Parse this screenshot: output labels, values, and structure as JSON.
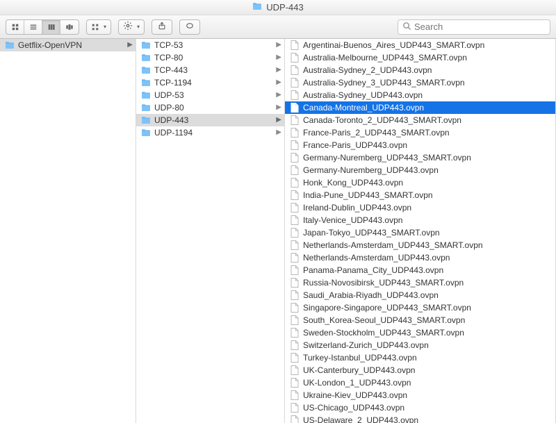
{
  "window": {
    "title": "UDP-443"
  },
  "search": {
    "placeholder": "Search"
  },
  "col1": {
    "items": [
      {
        "name": "Getflix-OpenVPN",
        "selected": true
      }
    ]
  },
  "col2": {
    "items": [
      {
        "name": "TCP-53",
        "selected": false
      },
      {
        "name": "TCP-80",
        "selected": false
      },
      {
        "name": "TCP-443",
        "selected": false
      },
      {
        "name": "TCP-1194",
        "selected": false
      },
      {
        "name": "UDP-53",
        "selected": false
      },
      {
        "name": "UDP-80",
        "selected": false
      },
      {
        "name": "UDP-443",
        "selected": true
      },
      {
        "name": "UDP-1194",
        "selected": false
      }
    ]
  },
  "col3": {
    "selected_index": 5,
    "items": [
      "Argentinai-Buenos_Aires_UDP443_SMART.ovpn",
      "Australia-Melbourne_UDP443_SMART.ovpn",
      "Australia-Sydney_2_UDP443.ovpn",
      "Australia-Sydney_3_UDP443_SMART.ovpn",
      "Australia-Sydney_UDP443.ovpn",
      "Canada-Montreal_UDP443.ovpn",
      "Canada-Toronto_2_UDP443_SMART.ovpn",
      "France-Paris_2_UDP443_SMART.ovpn",
      "France-Paris_UDP443.ovpn",
      "Germany-Nuremberg_UDP443_SMART.ovpn",
      "Germany-Nuremberg_UDP443.ovpn",
      "Honk_Kong_UDP443.ovpn",
      "India-Pune_UDP443_SMART.ovpn",
      "Ireland-Dublin_UDP443.ovpn",
      "Italy-Venice_UDP443.ovpn",
      "Japan-Tokyo_UDP443_SMART.ovpn",
      "Netherlands-Amsterdam_UDP443_SMART.ovpn",
      "Netherlands-Amsterdam_UDP443.ovpn",
      "Panama-Panama_City_UDP443.ovpn",
      "Russia-Novosibirsk_UDP443_SMART.ovpn",
      "Saudi_Arabia-Riyadh_UDP443.ovpn",
      "Singapore-Singapore_UDP443_SMART.ovpn",
      "South_Korea-Seoul_UDP443_SMART.ovpn",
      "Sweden-Stockholm_UDP443_SMART.ovpn",
      "Switzerland-Zurich_UDP443.ovpn",
      "Turkey-Istanbul_UDP443.ovpn",
      "UK-Canterbury_UDP443.ovpn",
      "UK-London_1_UDP443.ovpn",
      "Ukraine-Kiev_UDP443.ovpn",
      "US-Chicago_UDP443.ovpn",
      "US-Delaware_2_UDP443.ovpn"
    ]
  }
}
